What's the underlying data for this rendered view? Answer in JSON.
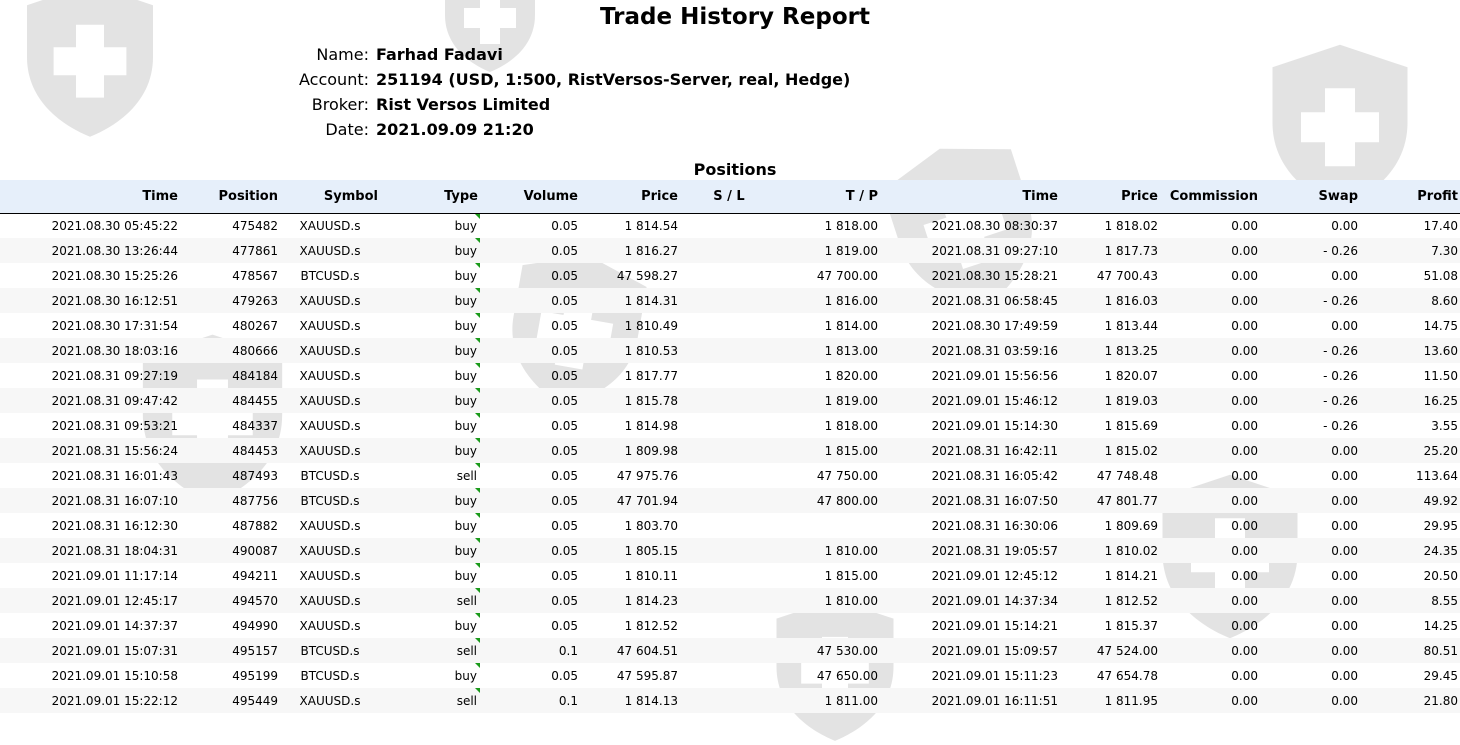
{
  "report": {
    "title": "Trade History Report",
    "fields": [
      {
        "label": "Name:",
        "value": "Farhad Fadavi"
      },
      {
        "label": "Account:",
        "value": "251194 (USD, 1:500, RistVersos-Server, real, Hedge)"
      },
      {
        "label": "Broker:",
        "value": "Rist Versos Limited"
      },
      {
        "label": "Date:",
        "value": "2021.09.09 21:20"
      }
    ]
  },
  "positions": {
    "title": "Positions",
    "columns": [
      "Time",
      "Position",
      "Symbol",
      "Type",
      "Volume",
      "Price",
      "S / L",
      "T / P",
      "Time",
      "Price",
      "Commission",
      "Swap",
      "Profit"
    ],
    "rows": [
      [
        "2021.08.30 05:45:22",
        "475482",
        "XAUUSD.s",
        "buy",
        "0.05",
        "1 814.54",
        "",
        "1 818.00",
        "2021.08.30 08:30:37",
        "1 818.02",
        "0.00",
        "0.00",
        "17.40"
      ],
      [
        "2021.08.30 13:26:44",
        "477861",
        "XAUUSD.s",
        "buy",
        "0.05",
        "1 816.27",
        "",
        "1 819.00",
        "2021.08.31 09:27:10",
        "1 817.73",
        "0.00",
        "- 0.26",
        "7.30"
      ],
      [
        "2021.08.30 15:25:26",
        "478567",
        "BTCUSD.s",
        "buy",
        "0.05",
        "47 598.27",
        "",
        "47 700.00",
        "2021.08.30 15:28:21",
        "47 700.43",
        "0.00",
        "0.00",
        "51.08"
      ],
      [
        "2021.08.30 16:12:51",
        "479263",
        "XAUUSD.s",
        "buy",
        "0.05",
        "1 814.31",
        "",
        "1 816.00",
        "2021.08.31 06:58:45",
        "1 816.03",
        "0.00",
        "- 0.26",
        "8.60"
      ],
      [
        "2021.08.30 17:31:54",
        "480267",
        "XAUUSD.s",
        "buy",
        "0.05",
        "1 810.49",
        "",
        "1 814.00",
        "2021.08.30 17:49:59",
        "1 813.44",
        "0.00",
        "0.00",
        "14.75"
      ],
      [
        "2021.08.30 18:03:16",
        "480666",
        "XAUUSD.s",
        "buy",
        "0.05",
        "1 810.53",
        "",
        "1 813.00",
        "2021.08.31 03:59:16",
        "1 813.25",
        "0.00",
        "- 0.26",
        "13.60"
      ],
      [
        "2021.08.31 09:27:19",
        "484184",
        "XAUUSD.s",
        "buy",
        "0.05",
        "1 817.77",
        "",
        "1 820.00",
        "2021.09.01 15:56:56",
        "1 820.07",
        "0.00",
        "- 0.26",
        "11.50"
      ],
      [
        "2021.08.31 09:47:42",
        "484455",
        "XAUUSD.s",
        "buy",
        "0.05",
        "1 815.78",
        "",
        "1 819.00",
        "2021.09.01 15:46:12",
        "1 819.03",
        "0.00",
        "- 0.26",
        "16.25"
      ],
      [
        "2021.08.31 09:53:21",
        "484337",
        "XAUUSD.s",
        "buy",
        "0.05",
        "1 814.98",
        "",
        "1 818.00",
        "2021.09.01 15:14:30",
        "1 815.69",
        "0.00",
        "- 0.26",
        "3.55"
      ],
      [
        "2021.08.31 15:56:24",
        "484453",
        "XAUUSD.s",
        "buy",
        "0.05",
        "1 809.98",
        "",
        "1 815.00",
        "2021.08.31 16:42:11",
        "1 815.02",
        "0.00",
        "0.00",
        "25.20"
      ],
      [
        "2021.08.31 16:01:43",
        "487493",
        "BTCUSD.s",
        "sell",
        "0.05",
        "47 975.76",
        "",
        "47 750.00",
        "2021.08.31 16:05:42",
        "47 748.48",
        "0.00",
        "0.00",
        "113.64"
      ],
      [
        "2021.08.31 16:07:10",
        "487756",
        "BTCUSD.s",
        "buy",
        "0.05",
        "47 701.94",
        "",
        "47 800.00",
        "2021.08.31 16:07:50",
        "47 801.77",
        "0.00",
        "0.00",
        "49.92"
      ],
      [
        "2021.08.31 16:12:30",
        "487882",
        "XAUUSD.s",
        "buy",
        "0.05",
        "1 803.70",
        "",
        "",
        "2021.08.31 16:30:06",
        "1 809.69",
        "0.00",
        "0.00",
        "29.95"
      ],
      [
        "2021.08.31 18:04:31",
        "490087",
        "XAUUSD.s",
        "buy",
        "0.05",
        "1 805.15",
        "",
        "1 810.00",
        "2021.08.31 19:05:57",
        "1 810.02",
        "0.00",
        "0.00",
        "24.35"
      ],
      [
        "2021.09.01 11:17:14",
        "494211",
        "XAUUSD.s",
        "buy",
        "0.05",
        "1 810.11",
        "",
        "1 815.00",
        "2021.09.01 12:45:12",
        "1 814.21",
        "0.00",
        "0.00",
        "20.50"
      ],
      [
        "2021.09.01 12:45:17",
        "494570",
        "XAUUSD.s",
        "sell",
        "0.05",
        "1 814.23",
        "",
        "1 810.00",
        "2021.09.01 14:37:34",
        "1 812.52",
        "0.00",
        "0.00",
        "8.55"
      ],
      [
        "2021.09.01 14:37:37",
        "494990",
        "XAUUSD.s",
        "buy",
        "0.05",
        "1 812.52",
        "",
        "",
        "2021.09.01 15:14:21",
        "1 815.37",
        "0.00",
        "0.00",
        "14.25"
      ],
      [
        "2021.09.01 15:07:31",
        "495157",
        "BTCUSD.s",
        "sell",
        "0.1",
        "47 604.51",
        "",
        "47 530.00",
        "2021.09.01 15:09:57",
        "47 524.00",
        "0.00",
        "0.00",
        "80.51"
      ],
      [
        "2021.09.01 15:10:58",
        "495199",
        "BTCUSD.s",
        "buy",
        "0.05",
        "47 595.87",
        "",
        "47 650.00",
        "2021.09.01 15:11:23",
        "47 654.78",
        "0.00",
        "0.00",
        "29.45"
      ],
      [
        "2021.09.01 15:22:12",
        "495449",
        "XAUUSD.s",
        "sell",
        "0.1",
        "1 814.13",
        "",
        "1 811.00",
        "2021.09.01 16:11:51",
        "1 811.95",
        "0.00",
        "0.00",
        "21.80"
      ]
    ]
  },
  "watermark": {
    "icon": "shield-cross-icon",
    "color": "#d9d9d9"
  }
}
